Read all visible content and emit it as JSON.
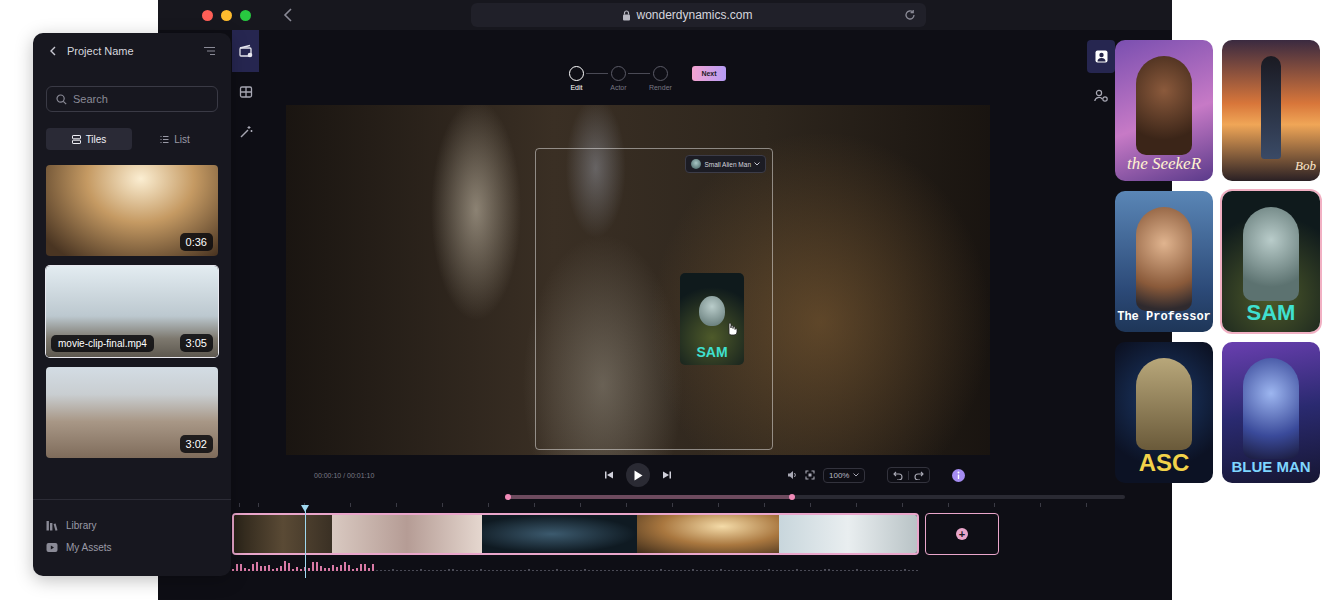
{
  "browser": {
    "url": "wonderdynamics.com"
  },
  "project_panel": {
    "title": "Project Name",
    "search": {
      "placeholder": "Search"
    },
    "view_toggle": [
      {
        "label": "Tiles",
        "selected": true
      },
      {
        "label": "List",
        "selected": false
      }
    ],
    "clips": [
      {
        "duration": "0:36",
        "hovered": false
      },
      {
        "name": "movie-clip-final.mp4",
        "duration": "3:05",
        "hovered": true
      },
      {
        "duration": "3:02",
        "hovered": false
      }
    ],
    "nav": [
      {
        "label": "Library"
      },
      {
        "label": "My Assets"
      }
    ]
  },
  "tool_rail": [
    {
      "selected": true
    },
    {
      "selected": false
    },
    {
      "selected": false
    }
  ],
  "account_rail": [
    {
      "selected": true
    },
    {
      "selected": false
    }
  ],
  "stepper": {
    "steps": [
      {
        "label": "Edit",
        "selected": true
      },
      {
        "label": "Actor",
        "selected": false
      },
      {
        "label": "Render",
        "selected": false
      }
    ],
    "next": "Next"
  },
  "video": {
    "actor_select": "Small Alien Man",
    "dragged_card": "SAM"
  },
  "player": {
    "time": "00:00:10 / 00:01:10",
    "zoom": "100%"
  },
  "timeline": {
    "playhead": {
      "level": 0.082
    },
    "scrub": {
      "level": 0.46
    },
    "add": "+"
  },
  "characters": [
    {
      "name": "the SeekeR",
      "selected": false
    },
    {
      "name": "Bob",
      "selected": false
    },
    {
      "name": "The Professor",
      "selected": false
    },
    {
      "name": "SAM",
      "selected": true
    },
    {
      "name": "ASC",
      "selected": false
    },
    {
      "name": "BLUE MAN",
      "selected": false
    }
  ]
}
